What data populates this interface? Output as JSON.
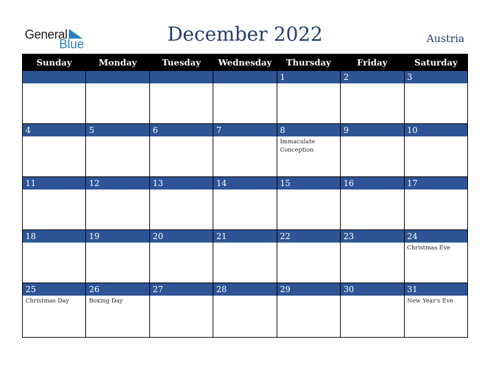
{
  "logo": {
    "line1": "General",
    "line2": "Blue"
  },
  "title": "December 2022",
  "country": "Austria",
  "colors": {
    "header_bg": "#000000",
    "band": "#2e5496",
    "title": "#253f6b",
    "logo_blue": "#2a7fc4"
  },
  "weekdays": [
    "Sunday",
    "Monday",
    "Tuesday",
    "Wednesday",
    "Thursday",
    "Friday",
    "Saturday"
  ],
  "weeks": [
    [
      {
        "day": "",
        "event": ""
      },
      {
        "day": "",
        "event": ""
      },
      {
        "day": "",
        "event": ""
      },
      {
        "day": "",
        "event": ""
      },
      {
        "day": "1",
        "event": ""
      },
      {
        "day": "2",
        "event": ""
      },
      {
        "day": "3",
        "event": ""
      }
    ],
    [
      {
        "day": "4",
        "event": ""
      },
      {
        "day": "5",
        "event": ""
      },
      {
        "day": "6",
        "event": ""
      },
      {
        "day": "7",
        "event": ""
      },
      {
        "day": "8",
        "event": "Immaculate Conception"
      },
      {
        "day": "9",
        "event": ""
      },
      {
        "day": "10",
        "event": ""
      }
    ],
    [
      {
        "day": "11",
        "event": ""
      },
      {
        "day": "12",
        "event": ""
      },
      {
        "day": "13",
        "event": ""
      },
      {
        "day": "14",
        "event": ""
      },
      {
        "day": "15",
        "event": ""
      },
      {
        "day": "16",
        "event": ""
      },
      {
        "day": "17",
        "event": ""
      }
    ],
    [
      {
        "day": "18",
        "event": ""
      },
      {
        "day": "19",
        "event": ""
      },
      {
        "day": "20",
        "event": ""
      },
      {
        "day": "21",
        "event": ""
      },
      {
        "day": "22",
        "event": ""
      },
      {
        "day": "23",
        "event": ""
      },
      {
        "day": "24",
        "event": "Christmas Eve"
      }
    ],
    [
      {
        "day": "25",
        "event": "Christmas Day"
      },
      {
        "day": "26",
        "event": "Boxing Day"
      },
      {
        "day": "27",
        "event": ""
      },
      {
        "day": "28",
        "event": ""
      },
      {
        "day": "29",
        "event": ""
      },
      {
        "day": "30",
        "event": ""
      },
      {
        "day": "31",
        "event": "New Year's Eve"
      }
    ]
  ]
}
